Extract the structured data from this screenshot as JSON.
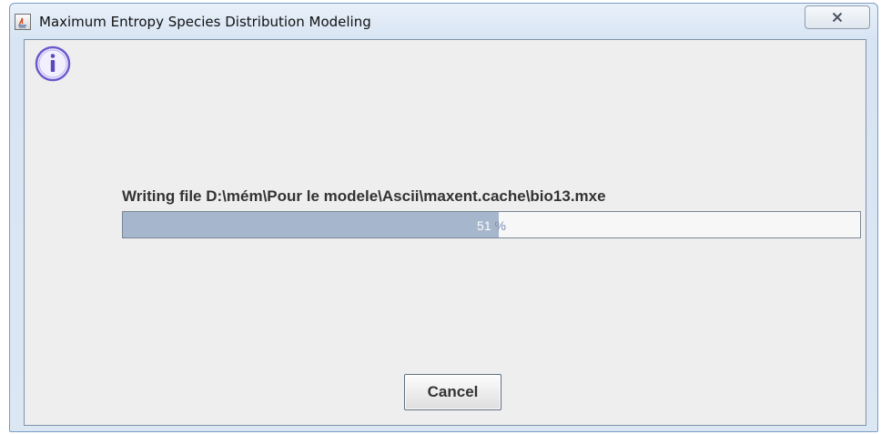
{
  "window": {
    "title": "Maximum Entropy Species Distribution Modeling",
    "app_icon": "java-icon",
    "close_icon": "close-icon"
  },
  "dialog": {
    "icon": "info-icon",
    "status_text": "Writing file D:\\mém\\Pour le modele\\Ascii\\maxent.cache\\bio13.mxe",
    "progress": {
      "percent": 51,
      "number_text": "51",
      "unit_text": " %"
    },
    "cancel_label": "Cancel"
  },
  "colors": {
    "progress_fill": "#a6b6cc",
    "info_icon_ring": "#6a5acd"
  }
}
